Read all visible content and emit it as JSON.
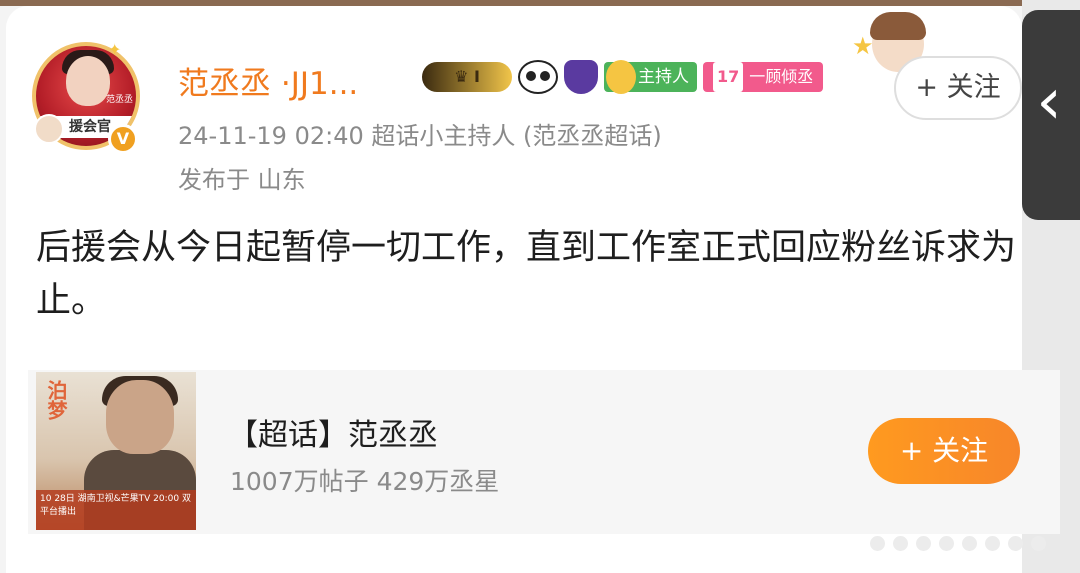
{
  "post": {
    "username": "范丞丞 ·ЈЈ1...",
    "time_source": "24-11-19 02:40  超话小主持人 (范丞丞超话)",
    "location": "发布于 山东",
    "text": "后援会从今日起暂停一切工作，直到工作室正式回应粉丝诉求为止。",
    "follow_label": "+ 关注",
    "avatar_band": "援会官",
    "avatar_tag": "范丞丞",
    "verified": "V",
    "badges": {
      "crown": "I",
      "host": "主持人",
      "level_num": "17",
      "level_text": "一顾倾丞"
    }
  },
  "topic": {
    "name": "【超话】范丞丞",
    "stats": "1007万帖子 429万丞星",
    "follow_label": "+ 关注",
    "image_title": "泊梦",
    "image_caption": "10 28日 湖南卫视&芒果TV 20:00 双平台播出"
  },
  "nav": {
    "back_icon": "chevron-left-icon"
  },
  "colors": {
    "username": "#f07a1e",
    "accent_orange": "#ff9a1f",
    "meta_gray": "#8a8a8a"
  }
}
